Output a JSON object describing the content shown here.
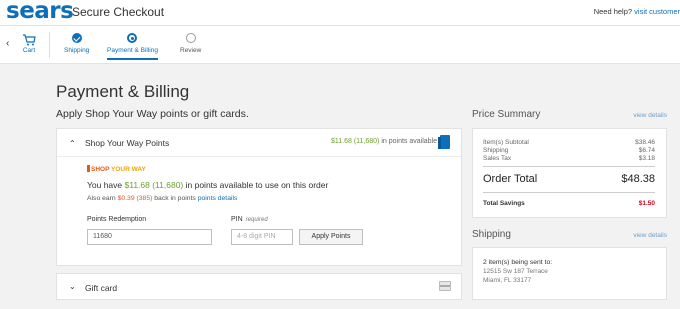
{
  "header": {
    "logo": "sears",
    "title": "Secure Checkout",
    "help_text": "Need help?",
    "help_link": "visit customer"
  },
  "nav": {
    "cart_label": "Cart",
    "steps": [
      {
        "label": "Shipping",
        "state": "done"
      },
      {
        "label": "Payment & Billing",
        "state": "active"
      },
      {
        "label": "Review",
        "state": "pending"
      }
    ]
  },
  "main": {
    "title": "Payment & Billing",
    "subtitle": "Apply Shop Your Way points or gift cards."
  },
  "syw": {
    "header_title": "Shop Your Way Points",
    "points_amount": "$11.68 (11,680)",
    "points_suffix": "in points available",
    "logo_shop": "SHOP ",
    "logo_way": "YOUR WAY",
    "have_prefix": "You have ",
    "have_amount": "$11.68 (11,680)",
    "have_suffix": " in points available to use on this order",
    "earn_prefix": "Also earn ",
    "earn_amount": "$0.39 (385)",
    "earn_suffix": " back in points ",
    "earn_link": "points details",
    "redemption_label": "Points Redemption",
    "redemption_value": "11680",
    "pin_label": "PIN",
    "pin_required": "required",
    "pin_placeholder": "4-8 digit PIN",
    "apply_button": "Apply Points"
  },
  "gift_card": {
    "title": "Gift card"
  },
  "price_summary": {
    "title": "Price Summary",
    "details_link": "view details",
    "rows": [
      {
        "label": "Item(s) Subtotal",
        "value": "$38.46"
      },
      {
        "label": "Shipping",
        "value": "$6.74"
      },
      {
        "label": "Sales Tax",
        "value": "$3.18"
      }
    ],
    "total_label": "Order Total",
    "total_value": "$48.38",
    "savings_label": "Total Savings",
    "savings_value": "$1.50"
  },
  "shipping": {
    "title": "Shipping",
    "details_link": "view details",
    "items_text": "2 item(s) being sent to:",
    "address_line1": "12515 Sw 187 Terrace",
    "address_line2": "Miami, FL 33177"
  },
  "colors": {
    "brand_blue": "#0d6fb8",
    "points_green": "#6aa22e",
    "earn_orange": "#e35a1c",
    "savings_red": "#d0021b"
  }
}
